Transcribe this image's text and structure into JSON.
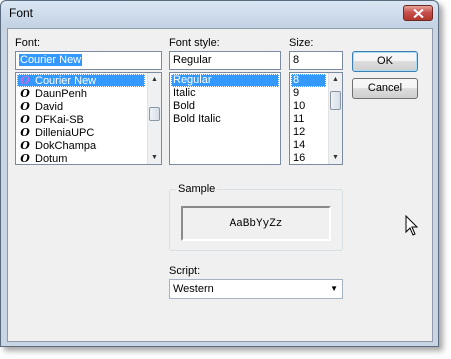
{
  "window": {
    "title": "Font"
  },
  "font": {
    "label": "Font:",
    "value": "Courier New",
    "items": [
      "Courier New",
      "DaunPenh",
      "David",
      "DFKai-SB",
      "DilleniaUPC",
      "DokChampa",
      "Dotum"
    ],
    "selected_index": 0,
    "item_icon": "opentype-font-icon"
  },
  "style": {
    "label": "Font style:",
    "value": "Regular",
    "items": [
      "Regular",
      "Italic",
      "Bold",
      "Bold Italic"
    ],
    "selected_index": 0
  },
  "size": {
    "label": "Size:",
    "value": "8",
    "items": [
      "8",
      "9",
      "10",
      "11",
      "12",
      "14",
      "16"
    ],
    "selected_index": 0
  },
  "buttons": {
    "ok": "OK",
    "cancel": "Cancel"
  },
  "sample": {
    "label": "Sample",
    "text": "AaBbYyZz"
  },
  "script": {
    "label": "Script:",
    "value": "Western"
  },
  "colors": {
    "selection": "#3399ff",
    "close_button": "#c75050",
    "dialog_bg": "#f0f0f0"
  }
}
